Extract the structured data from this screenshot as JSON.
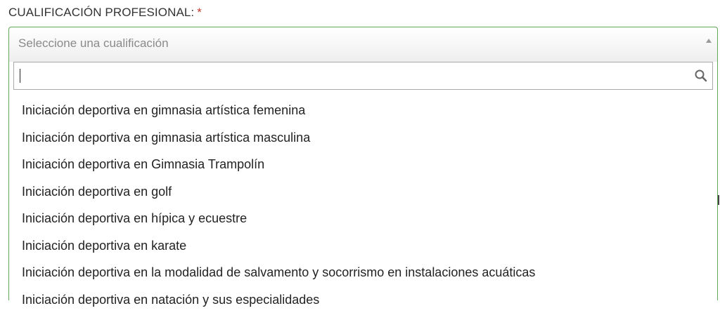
{
  "field": {
    "label": "CUALIFICACIÓN PROFESIONAL:",
    "required_mark": "*",
    "placeholder": "Seleccione una cualificación"
  },
  "search": {
    "value": "",
    "icon": "search-icon"
  },
  "options": [
    "Iniciación deportiva en gimnasia artística femenina",
    "Iniciación deportiva en gimnasia artística masculina",
    "Iniciación deportiva en Gimnasia Trampolín",
    "Iniciación deportiva en golf",
    "Iniciación deportiva en hípica y ecuestre",
    "Iniciación deportiva en karate",
    "Iniciación deportiva en la modalidad de salvamento y socorrismo en instalaciones acuáticas",
    "Iniciación deportiva en natación y sus especialidades"
  ],
  "colors": {
    "focus_border": "#5fa85a",
    "required": "#c0392b",
    "placeholder": "#8a8a8a"
  }
}
